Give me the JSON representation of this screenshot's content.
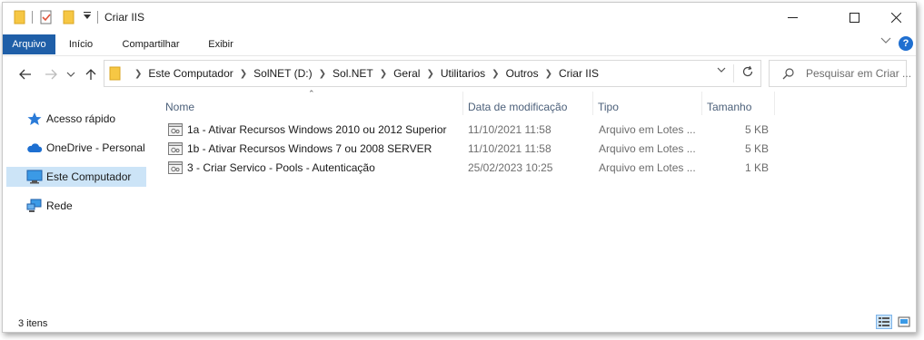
{
  "window": {
    "title": "Criar IIS",
    "minimize_icon": "minimize-icon",
    "maximize_icon": "maximize-icon",
    "close_icon": "close-icon"
  },
  "ribbon": {
    "tabs": [
      {
        "label": "Arquivo",
        "active": true
      },
      {
        "label": "Início",
        "active": false
      },
      {
        "label": "Compartilhar",
        "active": false
      },
      {
        "label": "Exibir",
        "active": false
      }
    ]
  },
  "address": {
    "crumbs": [
      "Este Computador",
      "SolNET (D:)",
      "Sol.NET",
      "Geral",
      "Utilitarios",
      "Outros",
      "Criar IIS"
    ]
  },
  "search": {
    "placeholder": "Pesquisar em Criar ..."
  },
  "sidebar": {
    "items": [
      {
        "label": "Acesso rápido",
        "icon": "star-icon",
        "selected": false
      },
      {
        "label": "OneDrive - Personal",
        "icon": "cloud-icon",
        "selected": false
      },
      {
        "label": "Este Computador",
        "icon": "computer-icon",
        "selected": true
      },
      {
        "label": "Rede",
        "icon": "network-icon",
        "selected": false
      }
    ]
  },
  "columns": {
    "name": "Nome",
    "date": "Data de modificação",
    "type": "Tipo",
    "size": "Tamanho"
  },
  "files": [
    {
      "name": "1a - Ativar Recursos Windows 2010 ou 2012 Superior",
      "date": "11/10/2021 11:58",
      "type": "Arquivo em Lotes ...",
      "size": "5 KB"
    },
    {
      "name": "1b - Ativar Recursos Windows 7 ou 2008 SERVER",
      "date": "11/10/2021 11:58",
      "type": "Arquivo em Lotes ...",
      "size": "5 KB"
    },
    {
      "name": "3 - Criar Servico - Pools - Autenticação",
      "date": "25/02/2023 10:25",
      "type": "Arquivo em Lotes ...",
      "size": "1 KB"
    }
  ],
  "status": {
    "count": "3 itens"
  },
  "colors": {
    "accent": "#1f5fa8",
    "selection": "#cce4f7",
    "folder": "#f6c744",
    "help": "#1f6fd0"
  }
}
